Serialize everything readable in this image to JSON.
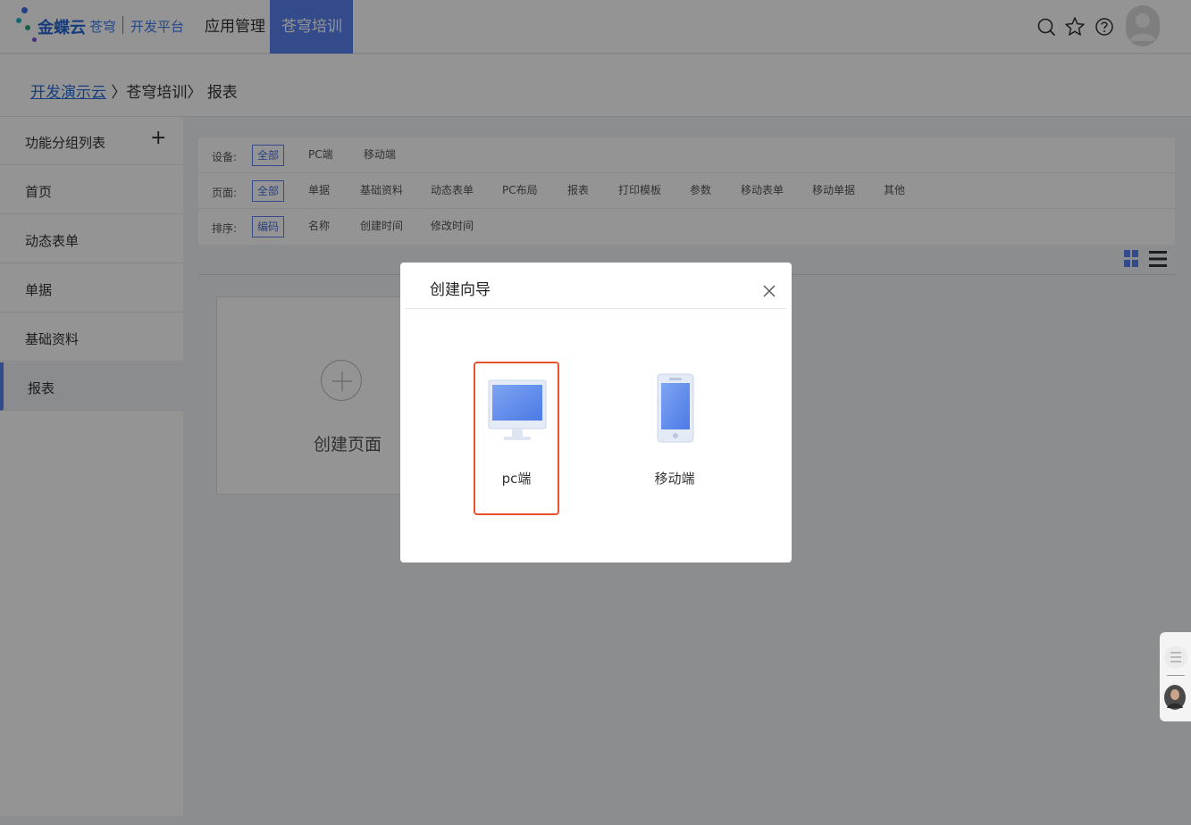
{
  "topbar": {
    "brand": "金蝶云",
    "brand_sub": "苍穹",
    "platform": "开发平台",
    "nav": [
      {
        "label": "应用管理",
        "active": false
      },
      {
        "label": "苍穹培训",
        "active": true
      }
    ],
    "icons": [
      "search-icon",
      "star-icon",
      "help-icon",
      "avatar"
    ],
    "accent": "#5a82f0"
  },
  "breadcrumb": {
    "link": "开发演示云",
    "sep1": "〉",
    "mid": "苍穹培训〉",
    "current": "报表"
  },
  "sidebar": {
    "header": "功能分组列表",
    "add": "+",
    "items": [
      {
        "label": "首页",
        "active": false
      },
      {
        "label": "动态表单",
        "active": false
      },
      {
        "label": "单据",
        "active": false
      },
      {
        "label": "基础资料",
        "active": false
      },
      {
        "label": "报表",
        "active": true
      }
    ]
  },
  "filters": {
    "device": {
      "label": "设备:",
      "options": [
        "全部",
        "PC端",
        "移动端"
      ],
      "selected": "全部"
    },
    "page": {
      "label": "页面:",
      "options": [
        "全部",
        "单据",
        "基础资料",
        "动态表单",
        "PC布局",
        "报表",
        "打印模板",
        "参数",
        "移动表单",
        "移动单据",
        "其他"
      ],
      "selected": "全部"
    },
    "sort": {
      "label": "排序:",
      "options": [
        "编码",
        "名称",
        "创建时间",
        "修改时间"
      ],
      "selected": "编码"
    }
  },
  "main": {
    "create_card_label": "创建页面",
    "view_icons": [
      "grid-view-icon",
      "list-view-icon"
    ]
  },
  "modal": {
    "title": "创建向导",
    "choices": [
      {
        "label": "pc端",
        "icon": "monitor-icon",
        "selected": true
      },
      {
        "label": "移动端",
        "icon": "phone-icon",
        "selected": false
      }
    ],
    "highlight_color": "#e8522c"
  }
}
